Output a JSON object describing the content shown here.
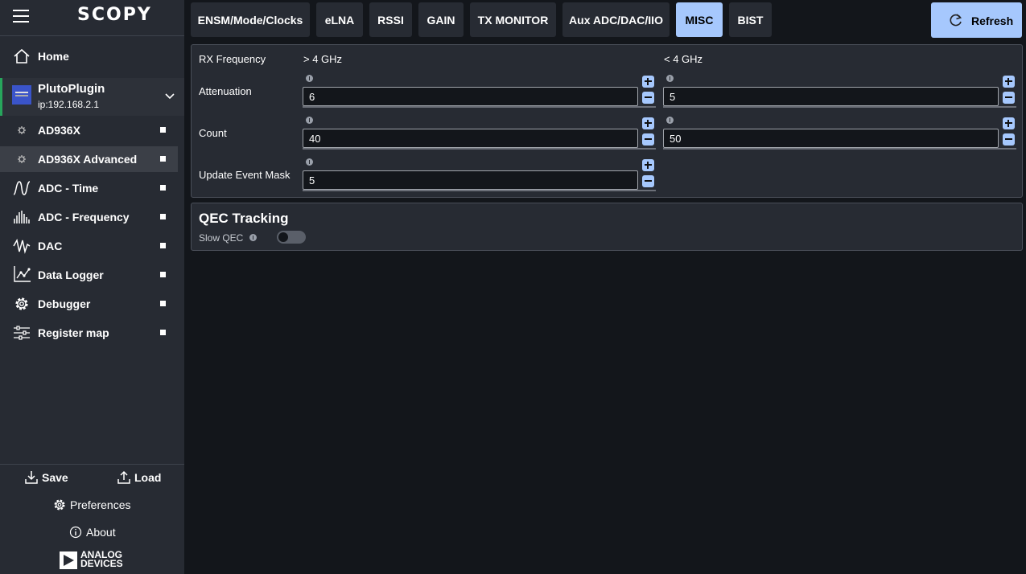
{
  "app": {
    "logo": "SCOPY"
  },
  "sidebar": {
    "home_label": "Home",
    "plugin": {
      "name": "PlutoPlugin",
      "ip": "ip:192.168.2.1"
    },
    "items": [
      {
        "label": "AD936X",
        "icon": "gear-small-icon"
      },
      {
        "label": "AD936X Advanced",
        "icon": "gear-small-icon",
        "active": true
      },
      {
        "label": "ADC - Time",
        "icon": "waveform-icon"
      },
      {
        "label": "ADC - Frequency",
        "icon": "spectrum-icon"
      },
      {
        "label": "DAC",
        "icon": "signal-icon"
      },
      {
        "label": "Data Logger",
        "icon": "chart-line-icon"
      },
      {
        "label": "Debugger",
        "icon": "gear-icon"
      },
      {
        "label": "Register map",
        "icon": "sliders-icon"
      }
    ],
    "footer": {
      "save_label": "Save",
      "load_label": "Load",
      "preferences_label": "Preferences",
      "about_label": "About",
      "brand_line1": "ANALOG",
      "brand_line2": "DEVICES"
    }
  },
  "tabs": [
    {
      "label": "ENSM/Mode/Clocks"
    },
    {
      "label": "eLNA"
    },
    {
      "label": "RSSI"
    },
    {
      "label": "GAIN"
    },
    {
      "label": "TX MONITOR"
    },
    {
      "label": "Aux ADC/DAC/IIO"
    },
    {
      "label": "MISC",
      "active": true
    },
    {
      "label": "BIST"
    }
  ],
  "toolbar": {
    "refresh_label": "Refresh"
  },
  "misc": {
    "rx_frequency_label": "RX Frequency",
    "col_high_label": "> 4 GHz",
    "col_low_label": "< 4 GHz",
    "attenuation": {
      "label": "Attenuation",
      "high": "6",
      "low": "5"
    },
    "count": {
      "label": "Count",
      "high": "40",
      "low": "50"
    },
    "update_event_mask": {
      "label": "Update Event Mask",
      "value": "5"
    }
  },
  "qec": {
    "title": "QEC Tracking",
    "slow_qec_label": "Slow QEC",
    "slow_qec_enabled": false
  },
  "colors": {
    "accent": "#a6c8fd",
    "sidebar_bg": "#272b33",
    "main_bg": "#13161b",
    "plugin_accent": "#27a55c"
  }
}
